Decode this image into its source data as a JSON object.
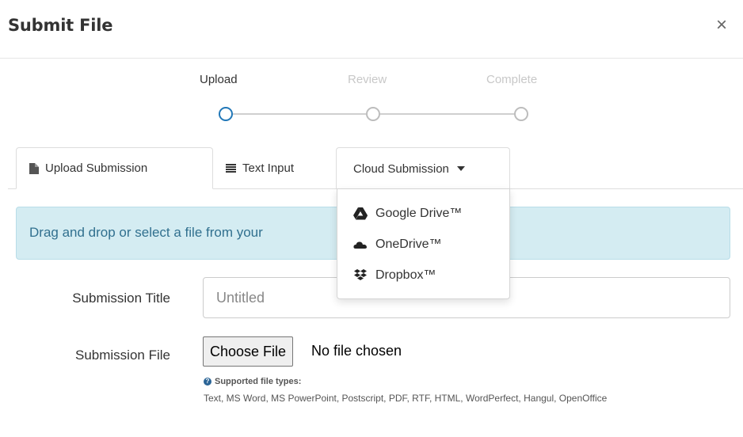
{
  "header": {
    "title": "Submit File",
    "close_glyph": "×"
  },
  "stepper": {
    "steps": [
      {
        "label": "Upload",
        "state": "active"
      },
      {
        "label": "Review",
        "state": "inactive"
      },
      {
        "label": "Complete",
        "state": "inactive"
      }
    ]
  },
  "tabs": {
    "upload": {
      "label": "Upload Submission",
      "icon": "file-icon"
    },
    "text": {
      "label": "Text Input",
      "icon": "align-justify-icon"
    },
    "cloud": {
      "label": "Cloud Submission",
      "icon": "caret-down-icon"
    }
  },
  "dropdown": {
    "items": [
      {
        "label": "Google Drive™",
        "icon": "google-drive-icon"
      },
      {
        "label": "OneDrive™",
        "icon": "onedrive-icon"
      },
      {
        "label": "Dropbox™",
        "icon": "dropbox-icon"
      }
    ]
  },
  "alert": {
    "text": "Drag and drop or select a file from your"
  },
  "form": {
    "title_label": "Submission Title",
    "title_placeholder": "Untitled",
    "file_label": "Submission File",
    "choose_button": "Choose File",
    "no_file": "No file chosen",
    "help_title": "Supported file types:",
    "help_text": "Text, MS Word, MS PowerPoint, Postscript, PDF, RTF, HTML, WordPerfect, Hangul, OpenOffice"
  },
  "colors": {
    "accent": "#2278b8",
    "alert_bg": "#d4ecf2",
    "alert_text": "#31708f"
  }
}
